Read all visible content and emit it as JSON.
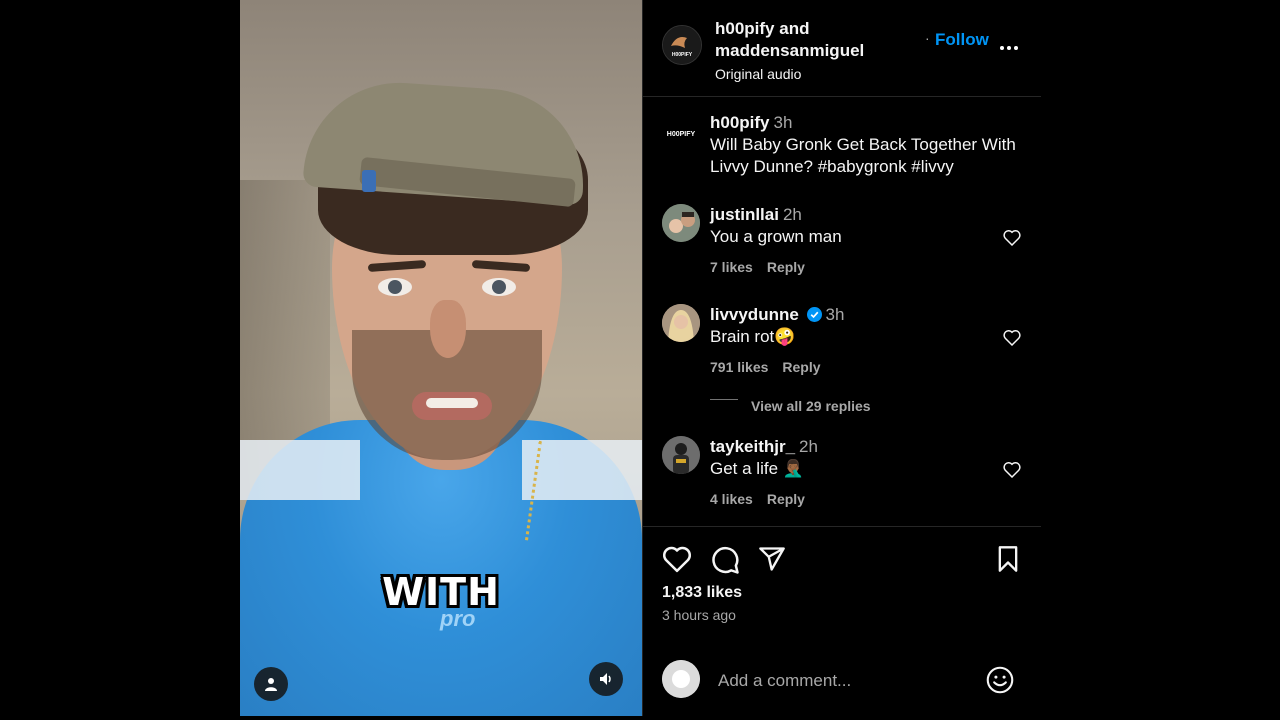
{
  "video": {
    "caption": "WITH",
    "shirt_logo": "pro",
    "profile_icon": "user-icon",
    "sound_icon": "speaker-icon"
  },
  "header": {
    "author_line1": "h00pify and",
    "author_line2": "maddensanmiguel",
    "audio": "Original audio",
    "follow_label": "Follow",
    "more_icon": "more-options-icon",
    "more_text": "•••",
    "avatar_text": "H00PIFY"
  },
  "post": {
    "user": "h00pify",
    "time": "3h",
    "text_line1": "Will Baby Gronk Get Back Together With",
    "text_line2": "Livvy Dunne? #babygronk #livvy",
    "avatar_text": "H00PIFY"
  },
  "comments": [
    {
      "user": "justinllai",
      "time": "2h",
      "text": "You a grown man",
      "likes": "7 likes",
      "reply": "Reply",
      "verified": false
    },
    {
      "user": "livvydunne",
      "time": "3h",
      "text": "Brain rot🤪",
      "likes": "791 likes",
      "reply": "Reply",
      "verified": true
    },
    {
      "user": "taykeithjr_",
      "time": "2h",
      "text": "Get a life 🤦🏾‍♂️",
      "likes": "4 likes",
      "reply": "Reply",
      "verified": false
    }
  ],
  "view_replies": "View all 29 replies",
  "actions": {
    "like_icon": "heart-icon",
    "comment_icon": "comment-icon",
    "share_icon": "send-icon",
    "save_icon": "bookmark-icon"
  },
  "likes_total": "1,833 likes",
  "posted_ago": "3 hours ago",
  "add_comment": {
    "placeholder": "Add a comment...",
    "emoji_icon": "emoji-icon"
  },
  "colors": {
    "background": "#000000",
    "link_blue": "#0095f6",
    "muted": "#a8a8a8",
    "text": "#f5f5f5",
    "divider": "#262626"
  }
}
